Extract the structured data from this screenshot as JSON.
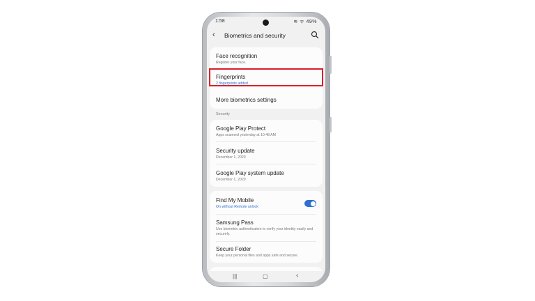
{
  "status_bar": {
    "time": "1:58",
    "indicators": "≋ ᯤ 49%"
  },
  "app_bar": {
    "back_icon": "‹",
    "title": "Biometrics and security"
  },
  "biometrics": [
    {
      "title": "Face recognition",
      "subtitle": "Register your face."
    },
    {
      "title": "Fingerprints",
      "subtitle": "2 fingerprints added"
    },
    {
      "title": "More biometrics settings"
    }
  ],
  "security_section": {
    "header": "Security",
    "items": [
      {
        "title": "Google Play Protect",
        "subtitle": "Apps scanned yesterday at 10:48 AM"
      },
      {
        "title": "Security update",
        "subtitle": "December 1, 2020"
      },
      {
        "title": "Google Play system update",
        "subtitle": "December 1, 2020"
      }
    ]
  },
  "more_items": [
    {
      "title": "Find My Mobile",
      "subtitle": "On without Remote unlock",
      "toggle_on": true
    },
    {
      "title": "Samsung Pass",
      "subtitle": "Use biometric authentication to verify your identity easily and securely."
    },
    {
      "title": "Secure Folder",
      "subtitle": "Keep your personal files and apps safe and secure."
    }
  ],
  "nav_bar": {
    "recents": "|||",
    "home": "▢",
    "back": "‹"
  },
  "colors": {
    "accent": "#2f6fd1",
    "highlight": "#d9202a"
  }
}
